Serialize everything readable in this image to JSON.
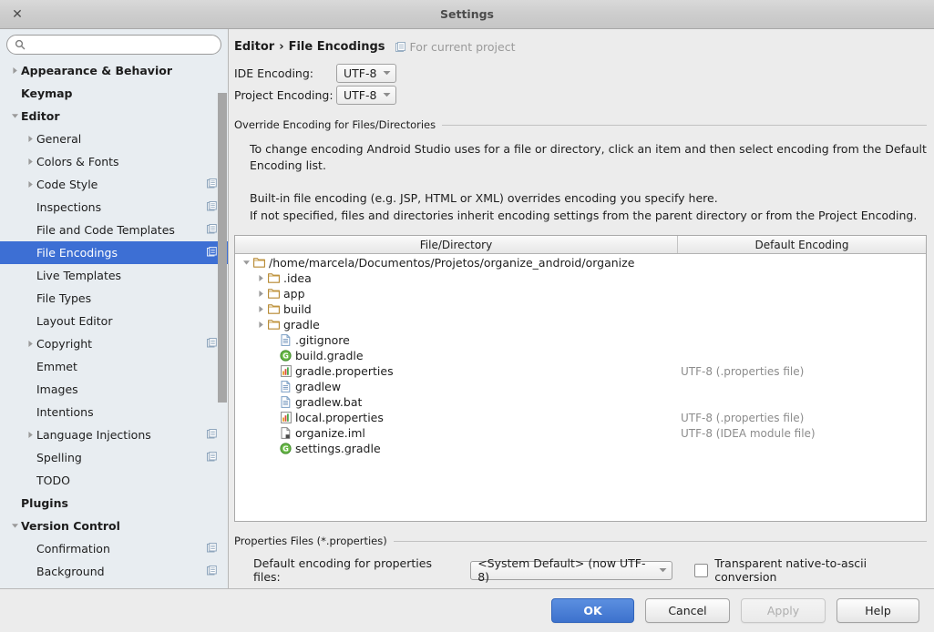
{
  "window": {
    "title": "Settings",
    "close_icon": "close-icon"
  },
  "sidebar": {
    "search": {
      "value": "",
      "placeholder": "",
      "icon": "search-icon"
    },
    "items": [
      {
        "label": "Appearance & Behavior",
        "level": 0,
        "bold": true,
        "arrow": "collapsed",
        "project_icon": false,
        "selected": false
      },
      {
        "label": "Keymap",
        "level": 0,
        "bold": true,
        "arrow": "none",
        "project_icon": false,
        "selected": false
      },
      {
        "label": "Editor",
        "level": 0,
        "bold": true,
        "arrow": "expanded",
        "project_icon": false,
        "selected": false
      },
      {
        "label": "General",
        "level": 1,
        "bold": false,
        "arrow": "collapsed",
        "project_icon": false,
        "selected": false
      },
      {
        "label": "Colors & Fonts",
        "level": 1,
        "bold": false,
        "arrow": "collapsed",
        "project_icon": false,
        "selected": false
      },
      {
        "label": "Code Style",
        "level": 1,
        "bold": false,
        "arrow": "collapsed",
        "project_icon": true,
        "selected": false
      },
      {
        "label": "Inspections",
        "level": 1,
        "bold": false,
        "arrow": "none",
        "project_icon": true,
        "selected": false
      },
      {
        "label": "File and Code Templates",
        "level": 1,
        "bold": false,
        "arrow": "none",
        "project_icon": true,
        "selected": false
      },
      {
        "label": "File Encodings",
        "level": 1,
        "bold": false,
        "arrow": "none",
        "project_icon": true,
        "selected": true
      },
      {
        "label": "Live Templates",
        "level": 1,
        "bold": false,
        "arrow": "none",
        "project_icon": false,
        "selected": false
      },
      {
        "label": "File Types",
        "level": 1,
        "bold": false,
        "arrow": "none",
        "project_icon": false,
        "selected": false
      },
      {
        "label": "Layout Editor",
        "level": 1,
        "bold": false,
        "arrow": "none",
        "project_icon": false,
        "selected": false
      },
      {
        "label": "Copyright",
        "level": 1,
        "bold": false,
        "arrow": "collapsed",
        "project_icon": true,
        "selected": false
      },
      {
        "label": "Emmet",
        "level": 1,
        "bold": false,
        "arrow": "none",
        "project_icon": false,
        "selected": false
      },
      {
        "label": "Images",
        "level": 1,
        "bold": false,
        "arrow": "none",
        "project_icon": false,
        "selected": false
      },
      {
        "label": "Intentions",
        "level": 1,
        "bold": false,
        "arrow": "none",
        "project_icon": false,
        "selected": false
      },
      {
        "label": "Language Injections",
        "level": 1,
        "bold": false,
        "arrow": "collapsed",
        "project_icon": true,
        "selected": false
      },
      {
        "label": "Spelling",
        "level": 1,
        "bold": false,
        "arrow": "none",
        "project_icon": true,
        "selected": false
      },
      {
        "label": "TODO",
        "level": 1,
        "bold": false,
        "arrow": "none",
        "project_icon": false,
        "selected": false
      },
      {
        "label": "Plugins",
        "level": 0,
        "bold": true,
        "arrow": "none",
        "project_icon": false,
        "selected": false
      },
      {
        "label": "Version Control",
        "level": 0,
        "bold": true,
        "arrow": "expanded",
        "project_icon": false,
        "selected": false
      },
      {
        "label": "Confirmation",
        "level": 1,
        "bold": false,
        "arrow": "none",
        "project_icon": true,
        "selected": false
      },
      {
        "label": "Background",
        "level": 1,
        "bold": false,
        "arrow": "none",
        "project_icon": true,
        "selected": false
      }
    ]
  },
  "main": {
    "breadcrumb": {
      "parent": "Editor",
      "separator": "›",
      "current": "File Encodings",
      "scope": "For current project",
      "scope_icon": "project-scope-icon"
    },
    "ide_encoding": {
      "label": "IDE Encoding:",
      "value": "UTF-8"
    },
    "project_encoding": {
      "label": "Project Encoding:",
      "value": "UTF-8"
    },
    "override_group": {
      "title": "Override Encoding for Files/Directories",
      "para1": "To change encoding Android Studio uses for a file or directory, click an item and then select encoding from the Default Encoding list.",
      "para2": "Built-in file encoding (e.g. JSP, HTML or XML) overrides encoding you specify here.",
      "para3": "If not specified, files and directories inherit encoding settings from the parent directory or from the Project Encoding."
    },
    "table": {
      "columns": [
        "File/Directory",
        "Default Encoding"
      ],
      "rows": [
        {
          "name": "/home/marcela/Documentos/Projetos/organize_android/organize",
          "icon": "folder-icon",
          "arrow": "expanded",
          "depth": 0,
          "encoding": ""
        },
        {
          "name": ".idea",
          "icon": "folder-icon",
          "arrow": "collapsed",
          "depth": 1,
          "encoding": ""
        },
        {
          "name": "app",
          "icon": "folder-icon",
          "arrow": "collapsed",
          "depth": 1,
          "encoding": ""
        },
        {
          "name": "build",
          "icon": "folder-icon",
          "arrow": "collapsed",
          "depth": 1,
          "encoding": ""
        },
        {
          "name": "gradle",
          "icon": "folder-icon",
          "arrow": "collapsed",
          "depth": 1,
          "encoding": ""
        },
        {
          "name": ".gitignore",
          "icon": "text-file-icon",
          "arrow": "none",
          "depth": 1,
          "encoding": ""
        },
        {
          "name": "build.gradle",
          "icon": "gradle-file-icon",
          "arrow": "none",
          "depth": 1,
          "encoding": ""
        },
        {
          "name": "gradle.properties",
          "icon": "properties-file-icon",
          "arrow": "none",
          "depth": 1,
          "encoding": "UTF-8 (.properties file)"
        },
        {
          "name": "gradlew",
          "icon": "text-file-icon",
          "arrow": "none",
          "depth": 1,
          "encoding": ""
        },
        {
          "name": "gradlew.bat",
          "icon": "text-file-icon",
          "arrow": "none",
          "depth": 1,
          "encoding": ""
        },
        {
          "name": "local.properties",
          "icon": "properties-file-icon",
          "arrow": "none",
          "depth": 1,
          "encoding": "UTF-8 (.properties file)"
        },
        {
          "name": "organize.iml",
          "icon": "module-file-icon",
          "arrow": "none",
          "depth": 1,
          "encoding": "UTF-8 (IDEA module file)"
        },
        {
          "name": "settings.gradle",
          "icon": "gradle-file-icon",
          "arrow": "none",
          "depth": 1,
          "encoding": ""
        }
      ]
    },
    "properties_group": {
      "title": "Properties Files (*.properties)",
      "default_encoding_label": "Default encoding for properties files:",
      "default_encoding_value": "<System Default> (now UTF-8)",
      "transparent_checkbox_label": "Transparent native-to-ascii conversion",
      "transparent_checkbox_checked": false
    }
  },
  "footer": {
    "ok": "OK",
    "cancel": "Cancel",
    "apply": "Apply",
    "help": "Help"
  },
  "colors": {
    "selection_blue": "#3d6fd4",
    "primary_button": "#3d72cd",
    "sidebar_bg": "#e8edf1",
    "dialog_bg": "#ececec",
    "muted_text": "#8c8c8c"
  }
}
